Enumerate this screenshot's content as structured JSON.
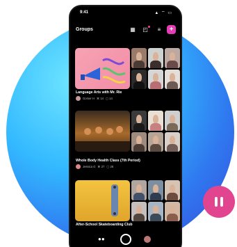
{
  "status": {
    "time": "9:41",
    "icons": "▲ ⌔ ▭"
  },
  "header": {
    "title": "Groups"
  },
  "groups": [
    {
      "title": "Language Arts with Mr. Rie",
      "owner": "Gomer H",
      "stat1": "⌘ 14",
      "stat2": "▢ 14"
    },
    {
      "title": "Whole Body Health Class (7th Period)",
      "owner": "Jessica G",
      "stat1": "⌘ 27",
      "stat2": "▢ 26"
    },
    {
      "title": "After-School Skateboarding Club",
      "owner": "",
      "stat1": "",
      "stat2": ""
    }
  ],
  "colors": {
    "accent": "#e53db5",
    "pause": "#e2458f"
  },
  "icons": {
    "pause": "pause-icon",
    "qr": "qr-icon",
    "notifications": "notification-icon",
    "filter": "filter-icon",
    "add": "plus-icon"
  }
}
